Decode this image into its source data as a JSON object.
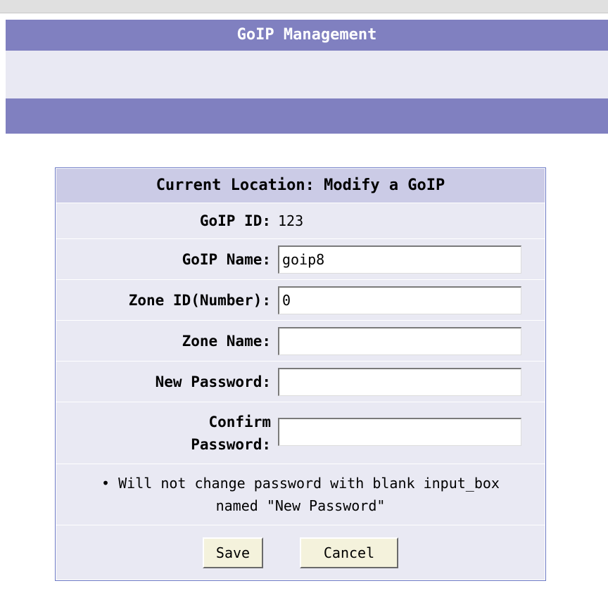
{
  "header": {
    "title": "GoIP Management"
  },
  "form": {
    "caption": "Current Location: Modify a GoIP",
    "goip_id_label": "GoIP ID:",
    "goip_id_value": "123",
    "goip_name_label": "GoIP Name:",
    "goip_name_value": "goip8",
    "zone_id_label": "Zone ID(Number):",
    "zone_id_value": "0",
    "zone_name_label": "Zone Name:",
    "zone_name_value": "",
    "new_password_label": "New Password:",
    "new_password_value": "",
    "confirm_password_label_line1": "Confirm",
    "confirm_password_label_line2": "Password:",
    "confirm_password_value": "",
    "note_bullet": "•",
    "note_text": "Will not change password with blank input_box named \"New Password\"",
    "save_label": "Save",
    "cancel_label": "Cancel"
  },
  "colors": {
    "header_bar": "#8080c0",
    "panel_row": "#e9e9f3",
    "caption_bg": "#cbcbe6",
    "panel_border": "#6b78c4",
    "button_bg": "#f4f2dc"
  }
}
